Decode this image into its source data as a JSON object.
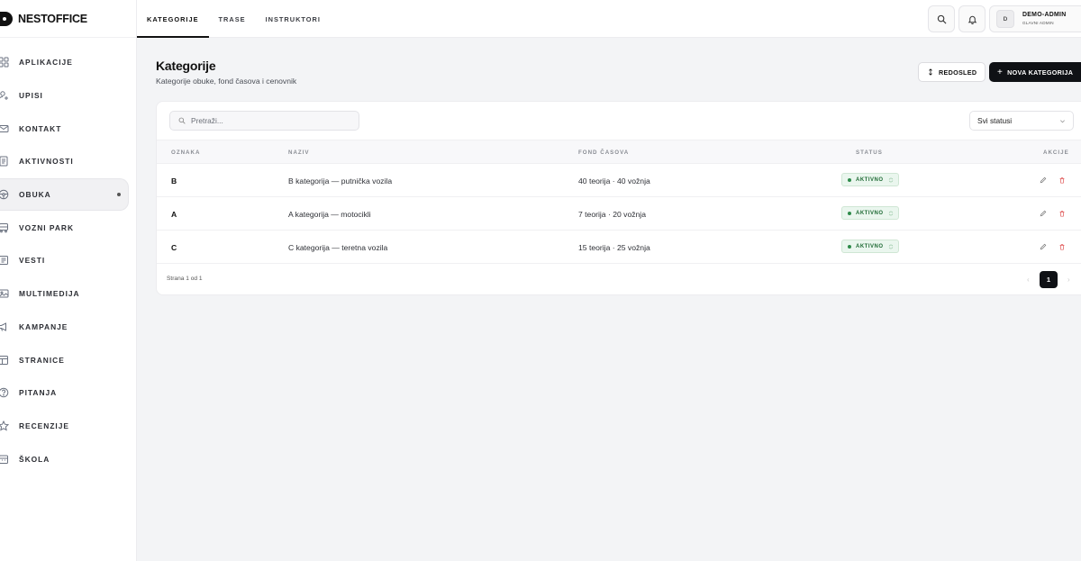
{
  "brand": {
    "name": "NESTOFFICE"
  },
  "sidebar": {
    "items": [
      {
        "label": "APLIKACIJE",
        "icon": "grid-icon"
      },
      {
        "label": "UPISI",
        "icon": "user-plus-icon"
      },
      {
        "label": "KONTAKT",
        "icon": "mail-icon"
      },
      {
        "label": "AKTIVNOSTI",
        "icon": "document-icon"
      },
      {
        "label": "OBUKA",
        "icon": "steering-wheel-icon",
        "active": true
      },
      {
        "label": "VOZNI PARK",
        "icon": "car-icon"
      },
      {
        "label": "VESTI",
        "icon": "newspaper-icon"
      },
      {
        "label": "MULTIMEDIJA",
        "icon": "image-icon"
      },
      {
        "label": "KAMPANJE",
        "icon": "megaphone-icon"
      },
      {
        "label": "STRANICE",
        "icon": "page-icon"
      },
      {
        "label": "PITANJA",
        "icon": "help-circle-icon"
      },
      {
        "label": "RECENZIJE",
        "icon": "star-icon"
      },
      {
        "label": "ŠKOLA",
        "icon": "building-icon"
      }
    ]
  },
  "topbar": {
    "tabs": [
      {
        "label": "KATEGORIJE",
        "active": true
      },
      {
        "label": "TRASE"
      },
      {
        "label": "INSTRUKTORI"
      }
    ],
    "user": {
      "initial": "D",
      "name": "DEMO-ADMIN",
      "role": "GLAVNI ADMIN"
    }
  },
  "page": {
    "title": "Kategorije",
    "subtitle": "Kategorije obuke, fond časova i cenovnik",
    "order_button": "REDOSLED",
    "new_button": "NOVA KATEGORIJA"
  },
  "filters": {
    "search_placeholder": "Pretraži...",
    "status_selected": "Svi statusi"
  },
  "table": {
    "columns": [
      "OZNAKA",
      "NAZIV",
      "FOND ČASOVA",
      "STATUS",
      "AKCIJE"
    ],
    "rows": [
      {
        "code": "B",
        "name": "B kategorija — putnička vozila",
        "hours": "40 teorija · 40 vožnja",
        "status": "AKTIVNO"
      },
      {
        "code": "A",
        "name": "A kategorija — motocikli",
        "hours": "7 teorija · 20 vožnja",
        "status": "AKTIVNO"
      },
      {
        "code": "C",
        "name": "C kategorija — teretna vozila",
        "hours": "15 teorija · 25 vožnja",
        "status": "AKTIVNO"
      }
    ]
  },
  "pagination": {
    "label": "Strana 1 od 1",
    "current": "1"
  },
  "colors": {
    "accent": "#0f1115",
    "active_badge_bg": "#eaf6ee",
    "active_badge_text": "#1f6b35",
    "delete": "#e05a5a"
  }
}
